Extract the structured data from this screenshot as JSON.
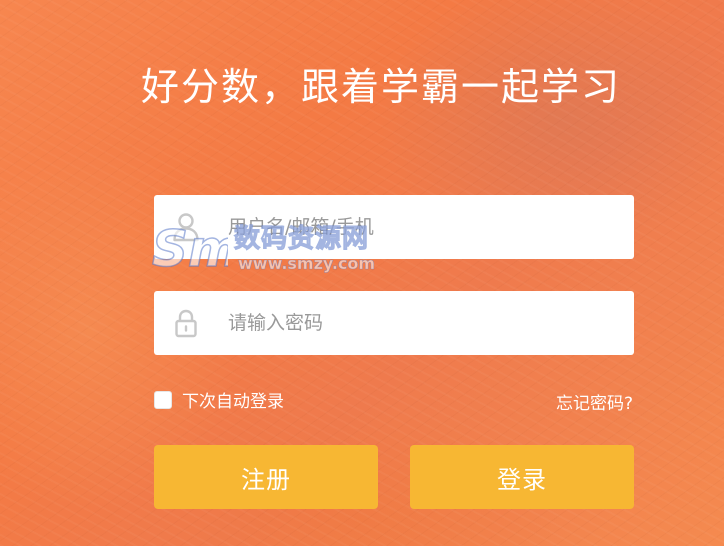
{
  "headline": "好分数，跟着学霸一起学习",
  "username": {
    "placeholder": "用户名/邮箱/手机",
    "value": "",
    "icon": "user-icon"
  },
  "password": {
    "placeholder": "请输入密码",
    "value": "",
    "icon": "lock-icon"
  },
  "remember": {
    "label": "下次自动登录",
    "checked": false
  },
  "forgot_label": "忘记密码?",
  "register_label": "注册",
  "login_label": "登录",
  "watermark": {
    "name": "数码资源网",
    "url": "www.smzy.com"
  },
  "colors": {
    "background": "#f47a44",
    "button": "#f7b733",
    "input_bg": "#ffffff",
    "placeholder": "#999999",
    "text_light": "#ffffff"
  }
}
